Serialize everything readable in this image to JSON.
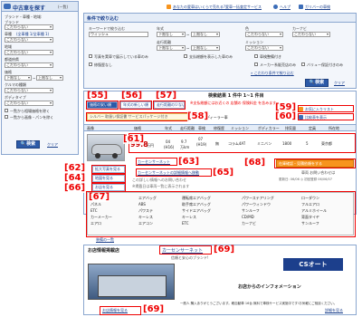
{
  "left_panel": {
    "title": "中古車を探す",
    "title_suffix": "(一覧)",
    "maker_label": "ブランド・車種・地域:",
    "brand_label": "ブランド",
    "brand_value": "こだわらない",
    "car_model_label": "車種",
    "car_model_hint": "(全車種 1/全車種 1)",
    "car_model_value": "こだわらない",
    "region_label": "地域",
    "region_value": "こだわらない",
    "pref_label": "都道府県",
    "pref_value": "こだわらない",
    "price_label": "価格",
    "price_low": "下限なし",
    "price_high": "上限なし",
    "color_label": "クルマの種類",
    "color_value": "こだわらない",
    "shop_label": "ボディタイプ",
    "shop_value": "こだわらない",
    "check1": "一覧から相場価格を除く",
    "check2": "一覧から画像・パンを除く",
    "search_button": "検索",
    "clear_button": "クリア"
  },
  "top_links": {
    "link1": "あなたの愛車はいくらで売れる?愛車一括査定サービス",
    "link2": "ヘルプ",
    "link3": "ガリバーの車検"
  },
  "filter_panel": {
    "title": "条件で絞り込む",
    "keyword_label": "キーワードで絞り込む",
    "keyword_value": "ウィッシュ",
    "year_label": "年式",
    "year_low": "下限なし",
    "year_high": "上限なし",
    "color_label": "色",
    "color_value": "こだわらない",
    "navi_label": "カーナビ",
    "navi_value": "こだわらない",
    "mileage_label": "走行距離",
    "mileage_low": "下限なし",
    "mileage_high": "上限なし",
    "mission_label": "ミッション",
    "mission_value": "こだわらない",
    "opt1": "写真を実車で展示している車のみ",
    "opt2": "支払総額を表示した車のみ",
    "opt3": "車検整備付き",
    "opt4": "修復歴なし",
    "opt5": "メーカー系販売店のみ",
    "opt6": "バリュー保証付きのみ",
    "more_link": "» こだわり条件で絞り込む",
    "search_button": "検索",
    "clear_button": "クリア"
  },
  "tabs": {
    "tab1": "価格の安い順",
    "tab2": "年式の新しい順",
    "tab3": "走行距離の少ない順"
  },
  "results": {
    "header": "検索結果 1 件中 1~1 件目",
    "notice": "※支払総額にはお近くの 店舗の 保険料金 を含みます",
    "right_link1": "お気に入りリスト",
    "right_link2": "比較表を表示",
    "label_badges": "シルバー 取扱い保証書 サービスパッケージ付き",
    "dealer_label": "ディーラー車"
  },
  "columns": [
    "画像",
    "価格",
    "年式",
    "走行距離",
    "車検",
    "修復歴",
    "ミッション",
    "ボディカラー",
    "排気量",
    "定員",
    "所在地"
  ],
  "row": {
    "price_main": "99.8",
    "price_unit": "万円",
    "year": "04",
    "year_sub": "(H16)",
    "mileage": "9.7",
    "mileage_unit": "万km",
    "shaken": "07",
    "shaken_sub": "(H19)",
    "repair": "無",
    "mission": "コラム4AT",
    "color": "ミニバン",
    "seats": "5",
    "displacement": "1800",
    "region": "東京都",
    "car_name": "ウィッシュ X エアロスポーツPKG",
    "pickup": "カーセンサーネット",
    "pickup_hint": "カーセンサーネットの詳細情報へ移動",
    "detail_btn": "在庫確認・見積依頼をする",
    "detail_sub": "車両 お問い合わせは",
    "photo_link": "拡大写真を見る",
    "map_link": "地図を見る",
    "shop_link": "お店を見る",
    "hint1": "この詳しい情報へのお問い合わせ",
    "hint2": "※掲載日は車両一覧に表示されます",
    "small_note": "更新日: 06/06 ◎ 初回登録 06/06/07"
  },
  "equipment": {
    "col1": [
      "ナビ",
      "パネル",
      "ETC",
      "カーメーカー",
      "エアロ",
      "エアクーラー"
    ],
    "col2": [
      "エアバッグ",
      "ABS",
      "パワステ",
      "キーレス",
      "エアコン"
    ],
    "col3": [
      "運転席エアバッグ",
      "助手席エアバッグ",
      "サイドエアバッグ",
      "キーレス",
      "ETC"
    ],
    "col4": [
      "パワーステアリング",
      "パワーウィンドウ",
      "サンルーフ",
      "CD/MD",
      "カーナビ",
      "DVD/TV"
    ],
    "col5": [
      "ローダウン",
      "フルエアロ",
      "アルミホイール",
      "背面タイヤ",
      "サンルーフ"
    ],
    "link": "装備の一覧"
  },
  "shop_section": {
    "title": "お店情報掲載店",
    "shop_name": "カーセンサーネット",
    "ad_text": "信頼と安心のブランド!",
    "logo_text": "CSオート",
    "info_title": "お店からのインフォメーション",
    "info_text": "一般人 購入ありがとうございます。軽自動車 16台 無料で車検サービス実施中です!お気軽にご相談ください。",
    "info_link": "詳細を見る",
    "shop_link": "お店情報を見る"
  },
  "callouts": [
    "[55]",
    "[56]",
    "[57]",
    "[58]",
    "[59]",
    "[60]",
    "[61]",
    "[62]",
    "[63]",
    "[64]",
    "[65]",
    "[66]",
    "[67]",
    "[68]",
    "[69]",
    "[69]"
  ]
}
